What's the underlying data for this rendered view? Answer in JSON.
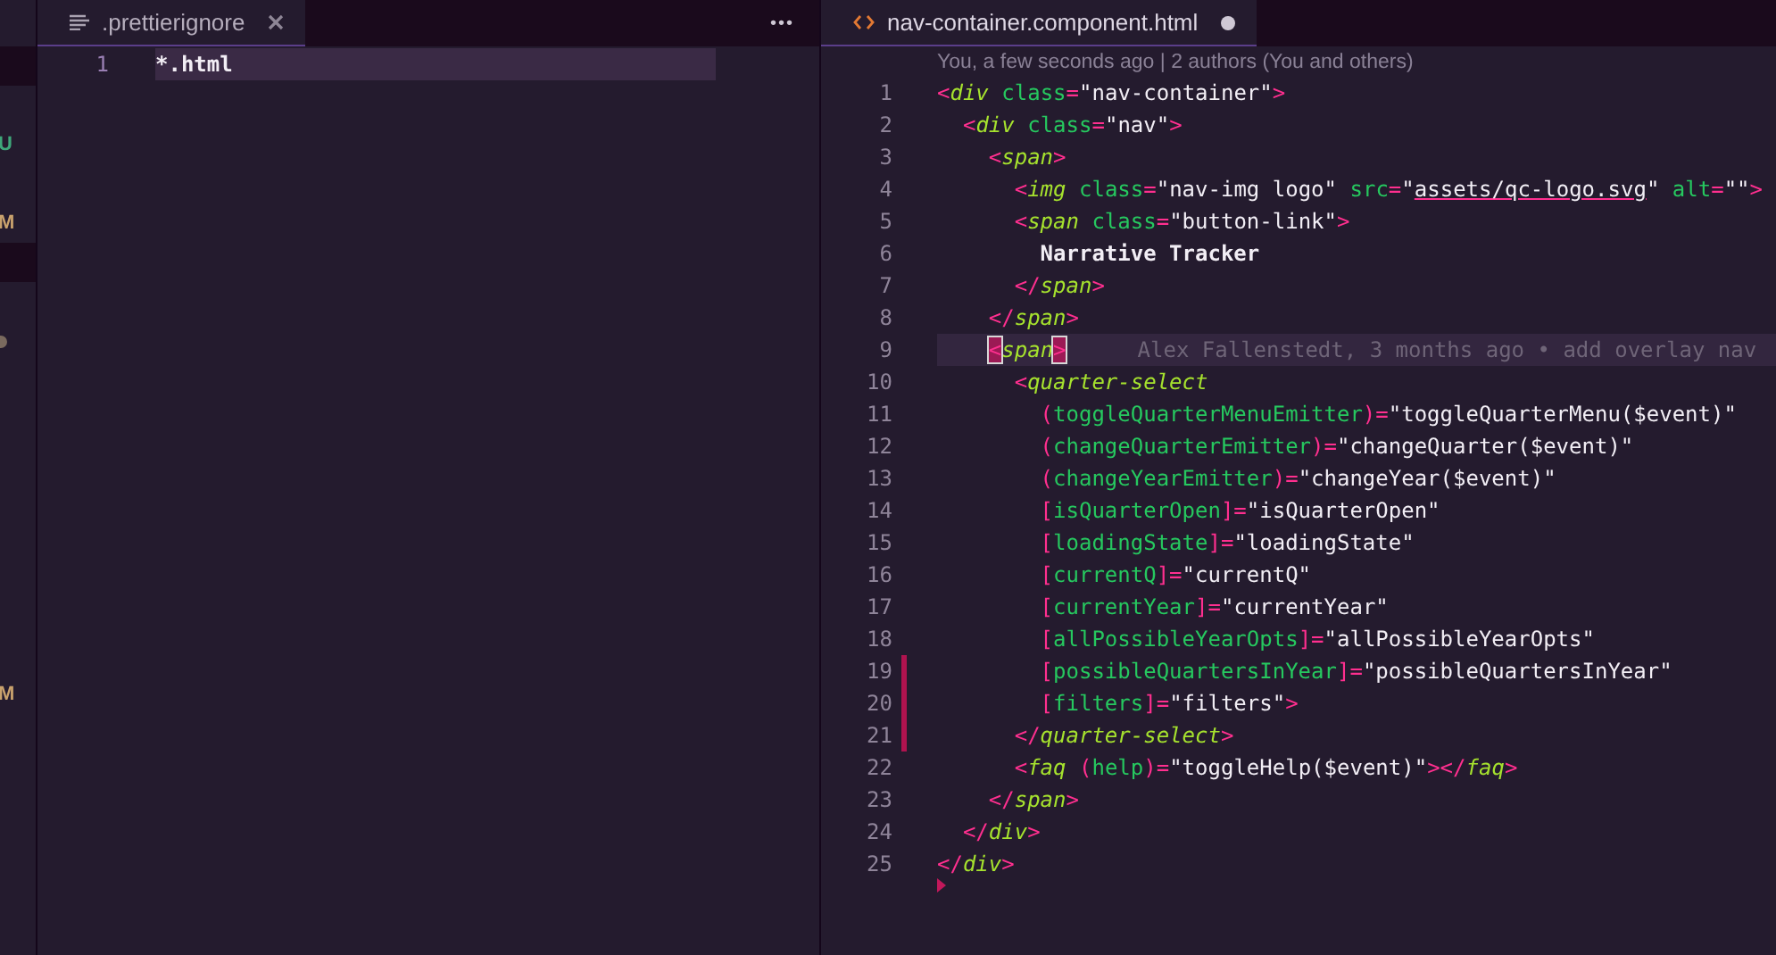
{
  "activity_strip": [
    {
      "kind": "band"
    },
    {
      "kind": "blank"
    },
    {
      "kind": "letter",
      "text": "U",
      "color": "#3fa77a"
    },
    {
      "kind": "blank"
    },
    {
      "kind": "letter",
      "text": "M",
      "color": "#c9a26d"
    },
    {
      "kind": "band"
    },
    {
      "kind": "blank"
    },
    {
      "kind": "dot"
    },
    {
      "kind": "blank"
    },
    {
      "kind": "blank"
    },
    {
      "kind": "blank"
    },
    {
      "kind": "blank"
    },
    {
      "kind": "blank"
    },
    {
      "kind": "blank"
    },
    {
      "kind": "blank"
    },
    {
      "kind": "blank"
    },
    {
      "kind": "letter",
      "text": "M",
      "color": "#c9a26d"
    }
  ],
  "left_pane": {
    "tab": {
      "label": ".prettierignore",
      "selected": true,
      "dirty": false
    },
    "more_button": "•••",
    "lines": [
      {
        "number": "1",
        "current": true,
        "tokens": [
          {
            "kind": "text",
            "text": "*.html"
          }
        ]
      }
    ]
  },
  "right_pane": {
    "tab": {
      "label": "nav-container.component.html",
      "selected": true,
      "dirty": true
    },
    "codelens": "You, a few seconds ago | 2 authors (You and others)",
    "lines": [
      {
        "number": "1",
        "current": false,
        "changed": false,
        "tokens": [
          {
            "kind": "p",
            "text": "<"
          },
          {
            "kind": "tag",
            "text": "div"
          },
          {
            "kind": "attr",
            "text": " class"
          },
          {
            "kind": "p",
            "text": "="
          },
          {
            "kind": "str",
            "text": "\"nav-container\""
          },
          {
            "kind": "p",
            "text": ">"
          }
        ]
      },
      {
        "number": "2",
        "current": false,
        "changed": false,
        "tokens": [
          {
            "kind": "p",
            "text": "  <"
          },
          {
            "kind": "tag",
            "text": "div"
          },
          {
            "kind": "attr",
            "text": " class"
          },
          {
            "kind": "p",
            "text": "="
          },
          {
            "kind": "str",
            "text": "\"nav\""
          },
          {
            "kind": "p",
            "text": ">"
          }
        ]
      },
      {
        "number": "3",
        "current": false,
        "changed": false,
        "tokens": [
          {
            "kind": "p",
            "text": "    <"
          },
          {
            "kind": "tag",
            "text": "span"
          },
          {
            "kind": "p",
            "text": ">"
          }
        ]
      },
      {
        "number": "4",
        "current": false,
        "changed": false,
        "tokens": [
          {
            "kind": "p",
            "text": "      <"
          },
          {
            "kind": "tag",
            "text": "img"
          },
          {
            "kind": "attr",
            "text": " class"
          },
          {
            "kind": "p",
            "text": "="
          },
          {
            "kind": "str",
            "text": "\"nav-img logo\""
          },
          {
            "kind": "attr",
            "text": " src"
          },
          {
            "kind": "p",
            "text": "="
          },
          {
            "kind": "str",
            "text": "\""
          },
          {
            "kind": "link",
            "text": "assets/qc-logo.svg"
          },
          {
            "kind": "str",
            "text": "\""
          },
          {
            "kind": "attr",
            "text": " alt"
          },
          {
            "kind": "p",
            "text": "="
          },
          {
            "kind": "str",
            "text": "\"\""
          },
          {
            "kind": "p",
            "text": ">"
          }
        ]
      },
      {
        "number": "5",
        "current": false,
        "changed": false,
        "tokens": [
          {
            "kind": "p",
            "text": "      <"
          },
          {
            "kind": "tag",
            "text": "span"
          },
          {
            "kind": "attr",
            "text": " class"
          },
          {
            "kind": "p",
            "text": "="
          },
          {
            "kind": "str",
            "text": "\"button-link\""
          },
          {
            "kind": "p",
            "text": ">"
          }
        ]
      },
      {
        "number": "6",
        "current": false,
        "changed": false,
        "tokens": [
          {
            "kind": "text",
            "text": "        Narrative Tracker"
          }
        ]
      },
      {
        "number": "7",
        "current": false,
        "changed": false,
        "tokens": [
          {
            "kind": "p",
            "text": "      </"
          },
          {
            "kind": "tag",
            "text": "span"
          },
          {
            "kind": "p",
            "text": ">"
          }
        ]
      },
      {
        "number": "8",
        "current": false,
        "changed": false,
        "tokens": [
          {
            "kind": "p",
            "text": "    </"
          },
          {
            "kind": "tag",
            "text": "span"
          },
          {
            "kind": "p",
            "text": ">"
          }
        ]
      },
      {
        "number": "9",
        "current": true,
        "changed": false,
        "blame": "Alex Fallenstedt, 3 months ago • add overlay nav",
        "tokens": [
          {
            "kind": "match",
            "text": "    <"
          },
          {
            "kind": "tag",
            "text": "span"
          },
          {
            "kind": "match",
            "text": ">"
          }
        ]
      },
      {
        "number": "10",
        "current": false,
        "changed": false,
        "tokens": [
          {
            "kind": "p",
            "text": "      <"
          },
          {
            "kind": "tag",
            "text": "quarter-select"
          }
        ]
      },
      {
        "number": "11",
        "current": false,
        "changed": false,
        "tokens": [
          {
            "kind": "p",
            "text": "        ("
          },
          {
            "kind": "attr",
            "text": "toggleQuarterMenuEmitter"
          },
          {
            "kind": "p",
            "text": ")="
          },
          {
            "kind": "str",
            "text": "\"toggleQuarterMenu($event)\""
          }
        ]
      },
      {
        "number": "12",
        "current": false,
        "changed": false,
        "tokens": [
          {
            "kind": "p",
            "text": "        ("
          },
          {
            "kind": "attr",
            "text": "changeQuarterEmitter"
          },
          {
            "kind": "p",
            "text": ")="
          },
          {
            "kind": "str",
            "text": "\"changeQuarter($event)\""
          }
        ]
      },
      {
        "number": "13",
        "current": false,
        "changed": false,
        "tokens": [
          {
            "kind": "p",
            "text": "        ("
          },
          {
            "kind": "attr",
            "text": "changeYearEmitter"
          },
          {
            "kind": "p",
            "text": ")="
          },
          {
            "kind": "str",
            "text": "\"changeYear($event)\""
          }
        ]
      },
      {
        "number": "14",
        "current": false,
        "changed": false,
        "tokens": [
          {
            "kind": "p",
            "text": "        ["
          },
          {
            "kind": "attr",
            "text": "isQuarterOpen"
          },
          {
            "kind": "p",
            "text": "]="
          },
          {
            "kind": "str",
            "text": "\"isQuarterOpen\""
          }
        ]
      },
      {
        "number": "15",
        "current": false,
        "changed": false,
        "tokens": [
          {
            "kind": "p",
            "text": "        ["
          },
          {
            "kind": "attr",
            "text": "loadingState"
          },
          {
            "kind": "p",
            "text": "]="
          },
          {
            "kind": "str",
            "text": "\"loadingState\""
          }
        ]
      },
      {
        "number": "16",
        "current": false,
        "changed": false,
        "tokens": [
          {
            "kind": "p",
            "text": "        ["
          },
          {
            "kind": "attr",
            "text": "currentQ"
          },
          {
            "kind": "p",
            "text": "]="
          },
          {
            "kind": "str",
            "text": "\"currentQ\""
          }
        ]
      },
      {
        "number": "17",
        "current": false,
        "changed": false,
        "tokens": [
          {
            "kind": "p",
            "text": "        ["
          },
          {
            "kind": "attr",
            "text": "currentYear"
          },
          {
            "kind": "p",
            "text": "]="
          },
          {
            "kind": "str",
            "text": "\"currentYear\""
          }
        ]
      },
      {
        "number": "18",
        "current": false,
        "changed": false,
        "tokens": [
          {
            "kind": "p",
            "text": "        ["
          },
          {
            "kind": "attr",
            "text": "allPossibleYearOpts"
          },
          {
            "kind": "p",
            "text": "]="
          },
          {
            "kind": "str",
            "text": "\"allPossibleYearOpts\""
          }
        ]
      },
      {
        "number": "19",
        "current": false,
        "changed": true,
        "tokens": [
          {
            "kind": "p",
            "text": "        ["
          },
          {
            "kind": "attr",
            "text": "possibleQuartersInYear"
          },
          {
            "kind": "p",
            "text": "]="
          },
          {
            "kind": "str",
            "text": "\"possibleQuartersInYear\""
          }
        ]
      },
      {
        "number": "20",
        "current": false,
        "changed": true,
        "tokens": [
          {
            "kind": "p",
            "text": "        ["
          },
          {
            "kind": "attr",
            "text": "filters"
          },
          {
            "kind": "p",
            "text": "]="
          },
          {
            "kind": "str",
            "text": "\"filters\""
          },
          {
            "kind": "p",
            "text": ">"
          }
        ]
      },
      {
        "number": "21",
        "current": false,
        "changed": true,
        "tokens": [
          {
            "kind": "p",
            "text": "      </"
          },
          {
            "kind": "tag",
            "text": "quarter-select"
          },
          {
            "kind": "p",
            "text": ">"
          }
        ]
      },
      {
        "number": "22",
        "current": false,
        "changed": false,
        "tokens": [
          {
            "kind": "p",
            "text": "      <"
          },
          {
            "kind": "tag",
            "text": "faq"
          },
          {
            "kind": "p",
            "text": " ("
          },
          {
            "kind": "attr",
            "text": "help"
          },
          {
            "kind": "p",
            "text": ")="
          },
          {
            "kind": "str",
            "text": "\"toggleHelp($event)\""
          },
          {
            "kind": "p",
            "text": "></"
          },
          {
            "kind": "tag",
            "text": "faq"
          },
          {
            "kind": "p",
            "text": ">"
          }
        ]
      },
      {
        "number": "23",
        "current": false,
        "changed": false,
        "tokens": [
          {
            "kind": "p",
            "text": "    </"
          },
          {
            "kind": "tag",
            "text": "span"
          },
          {
            "kind": "p",
            "text": ">"
          }
        ]
      },
      {
        "number": "24",
        "current": false,
        "changed": false,
        "tokens": [
          {
            "kind": "p",
            "text": "  </"
          },
          {
            "kind": "tag",
            "text": "div"
          },
          {
            "kind": "p",
            "text": ">"
          }
        ]
      },
      {
        "number": "25",
        "current": false,
        "changed": false,
        "deleted_below": true,
        "tokens": [
          {
            "kind": "p",
            "text": "</"
          },
          {
            "kind": "tag",
            "text": "div"
          },
          {
            "kind": "p",
            "text": ">"
          }
        ]
      }
    ]
  }
}
